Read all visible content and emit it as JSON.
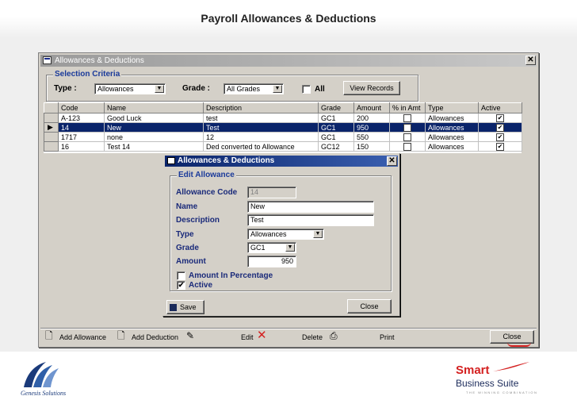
{
  "slide": {
    "title": "Payroll Allowances & Deductions"
  },
  "window": {
    "title": "Allowances & Deductions",
    "close_glyph": "✕",
    "selection": {
      "legend": "Selection Criteria",
      "type_label": "Type :",
      "type_value": "Allowances",
      "grade_label": "Grade :",
      "grade_value": "All Grades",
      "all_label": "All",
      "view_button": "View Records"
    },
    "grid": {
      "headers": [
        "Code",
        "Name",
        "Description",
        "Grade",
        "Amount",
        "% in Amt",
        "Type",
        "Active"
      ],
      "rows": [
        {
          "code": "A-123",
          "name": "Good Luck",
          "description": "test",
          "grade": "GC1",
          "amount": "200",
          "type": "Allowances"
        },
        {
          "code": "14",
          "name": "New",
          "description": "Test",
          "grade": "GC1",
          "amount": "950",
          "type": "Allowances"
        },
        {
          "code": "1717",
          "name": "none",
          "description": "12",
          "grade": "GC1",
          "amount": "550",
          "type": "Allowances"
        },
        {
          "code": "16",
          "name": "Test 14",
          "description": "Ded converted to Allowance",
          "grade": "GC12",
          "amount": "150",
          "type": "Allowances"
        }
      ],
      "row_indicator": "▶"
    },
    "toolbar": {
      "add_allowance": "Add Allowance",
      "add_deduction": "Add Deduction",
      "edit": "Edit",
      "delete": "Delete",
      "print": "Print",
      "close": "Close"
    }
  },
  "dialog": {
    "title": "Allowances & Deductions",
    "close_glyph": "✕",
    "legend": "Edit Allowance",
    "code_label": "Allowance Code",
    "code_value": "14",
    "name_label": "Name",
    "name_value": "New",
    "desc_label": "Description",
    "desc_value": "Test",
    "type_label": "Type",
    "type_value": "Allowances",
    "grade_label": "Grade",
    "grade_value": "GC1",
    "amount_label": "Amount",
    "amount_value": "950",
    "pct_label": "Amount In Percentage",
    "active_label": "Active",
    "save_button": "Save",
    "close_button": "Close"
  },
  "branding": {
    "left_logo_text": "Genesis Solutions",
    "right_brand_1": "Smart",
    "right_brand_2": "Business Suite",
    "right_tagline": "THE WINNING COMBINATION"
  },
  "colors": {
    "selection_row": "#0a246a",
    "dialog_title": "#0a246a",
    "label_blue": "#1a2a7a",
    "brand_red": "#d42020"
  }
}
